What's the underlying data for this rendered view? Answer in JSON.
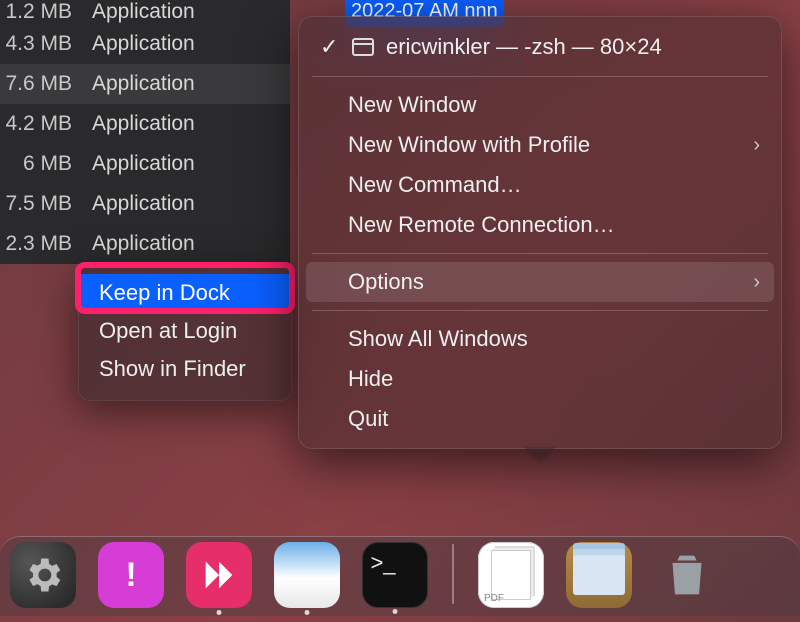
{
  "file_fragment": "2022-07   AM nnn",
  "finder": {
    "rows": [
      {
        "size": "1.2 MB",
        "kind": "Application"
      },
      {
        "size": "4.3 MB",
        "kind": "Application"
      },
      {
        "size": "7.6 MB",
        "kind": "Application"
      },
      {
        "size": "4.2 MB",
        "kind": "Application"
      },
      {
        "size": "6 MB",
        "kind": "Application"
      },
      {
        "size": "7.5 MB",
        "kind": "Application"
      },
      {
        "size": "2.3 MB",
        "kind": "Application"
      }
    ]
  },
  "options_menu": {
    "items": [
      {
        "label": "Keep in Dock",
        "highlighted": true
      },
      {
        "label": "Open at Login"
      },
      {
        "label": "Show in Finder"
      }
    ]
  },
  "ctx": {
    "header_check": "✓",
    "header_title": "ericwinkler — -zsh — 80×24",
    "groups": [
      [
        {
          "label": "New Window"
        },
        {
          "label": "New Window with Profile",
          "chevron": true
        },
        {
          "label": "New Command…"
        },
        {
          "label": "New Remote Connection…"
        }
      ],
      [
        {
          "label": "Options",
          "chevron": true,
          "hover": true
        }
      ],
      [
        {
          "label": "Show All Windows"
        },
        {
          "label": "Hide"
        },
        {
          "label": "Quit"
        }
      ]
    ]
  },
  "dock": {
    "icons_left": [
      {
        "name": "system-settings",
        "class": "ic-settings"
      },
      {
        "name": "feedback-assistant",
        "class": "ic-feedback"
      },
      {
        "name": "skitch",
        "class": "ic-skitch",
        "dot": true
      },
      {
        "name": "preview",
        "class": "ic-preview",
        "dot": true
      },
      {
        "name": "terminal",
        "class": "ic-terminal",
        "dot": true
      }
    ],
    "icons_right": [
      {
        "name": "pdf-document",
        "class": "ic-pdf"
      },
      {
        "name": "all-my-files",
        "class": "ic-files"
      },
      {
        "name": "trash",
        "class": "ic-trash"
      }
    ]
  }
}
